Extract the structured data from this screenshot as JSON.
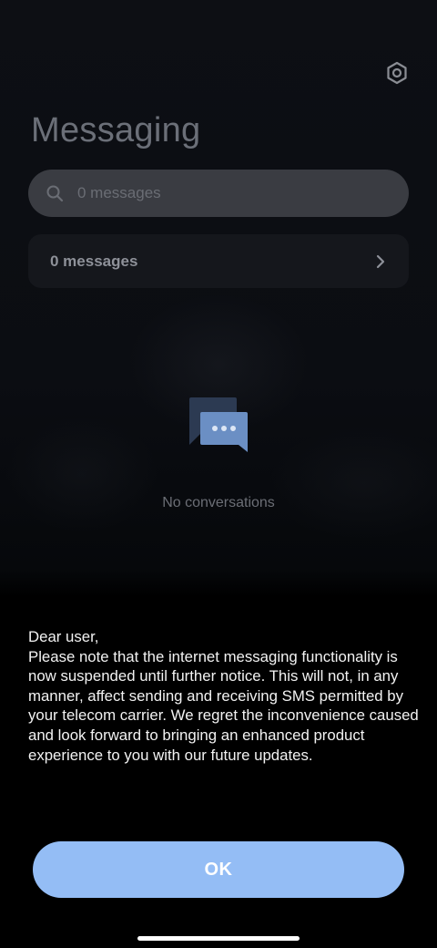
{
  "app": {
    "title": "Messaging"
  },
  "icons": {
    "settings": "gear-icon",
    "search": "search-icon",
    "chevron": "chevron-right-icon",
    "empty_state": "chat-bubbles-icon"
  },
  "search": {
    "placeholder": "0 messages"
  },
  "messages_row": {
    "label": "0 messages"
  },
  "empty_state": {
    "text": "No conversations"
  },
  "dialog": {
    "greeting": "Dear user,",
    "body": "Please note that the internet messaging functionality is now suspended until further notice. This will not, in any manner, affect sending and receiving SMS permitted by your telecom carrier. We regret the inconvenience caused and look forward to bringing an enhanced product experience to you with our future updates.",
    "ok_label": "OK"
  },
  "colors": {
    "accent": "#94bdf5",
    "background": "#000000",
    "search_bg": "#3a3c42",
    "row_bg": "#15171c"
  }
}
